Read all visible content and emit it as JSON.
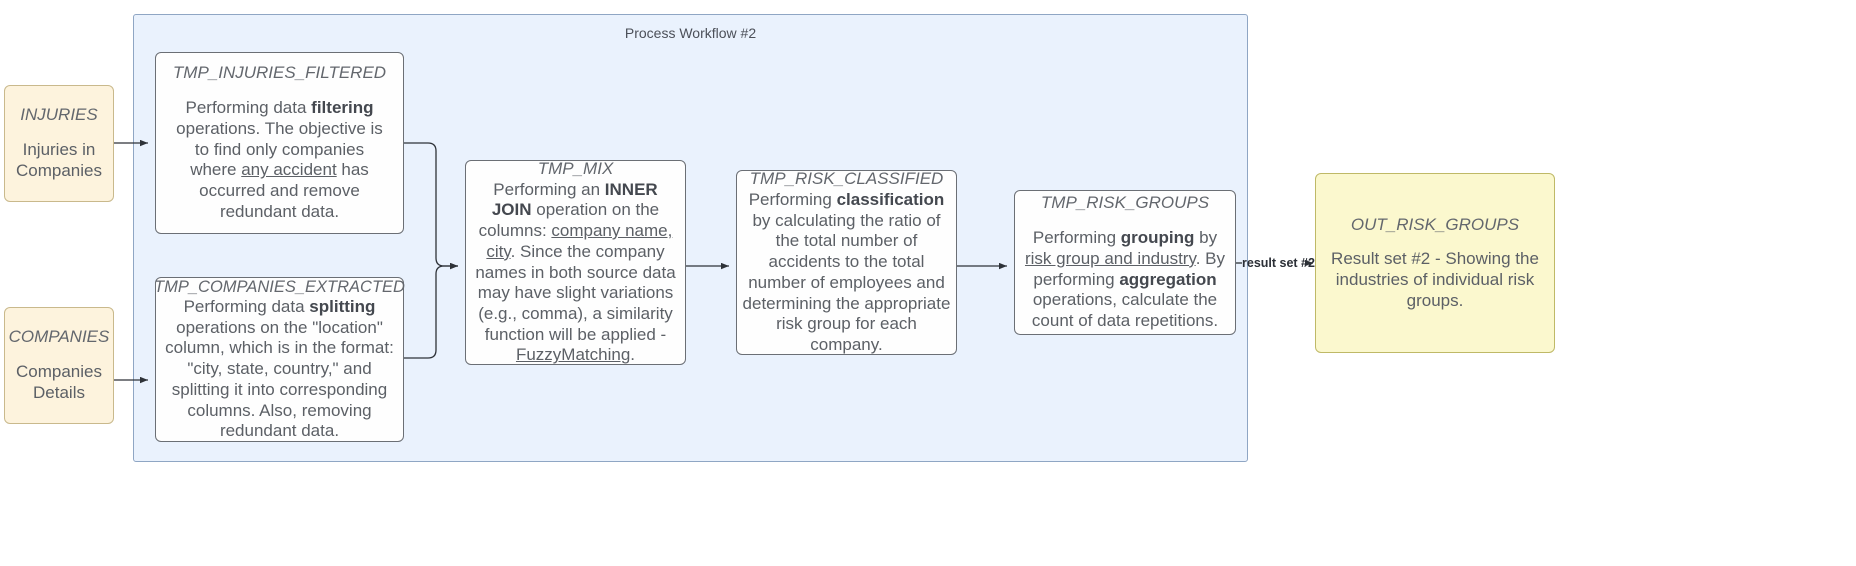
{
  "diagram": {
    "type": "flowchart",
    "cluster": {
      "label": "Process Workflow #2"
    },
    "nodes": {
      "injuries": {
        "id": "INJURIES",
        "title": "INJURIES",
        "body": "Injuries in Companies",
        "kind": "source",
        "color": "#fdf3dd"
      },
      "companies": {
        "id": "COMPANIES",
        "title": "COMPANIES",
        "body": "Companies Details",
        "kind": "source",
        "color": "#fdf3dd"
      },
      "tmp_injuries_filtered": {
        "id": "TMP_INJURIES_FILTERED",
        "title": "TMP_INJURIES_FILTERED",
        "body_parts": [
          {
            "t": "Performing data ",
            "s": "normal"
          },
          {
            "t": "filtering",
            "s": "bold"
          },
          {
            "t": " operations. The objective is to find only companies where ",
            "s": "normal"
          },
          {
            "t": "any accident",
            "s": "underline"
          },
          {
            "t": " has occurred and remove redundant data.",
            "s": "normal"
          }
        ],
        "kind": "process",
        "color": "#fefefe"
      },
      "tmp_companies_extracted": {
        "id": "TMP_COMPANIES_EXTRACTED",
        "title": "TMP_COMPANIES_EXTRACTED",
        "body_parts": [
          {
            "t": "Performing data ",
            "s": "normal"
          },
          {
            "t": "splitting",
            "s": "bold"
          },
          {
            "t": " operations on the \"location\" column, which is in the format: \"city, state, country,\" and splitting it into corresponding columns. Also, removing redundant data.",
            "s": "normal"
          }
        ],
        "kind": "process",
        "color": "#fefefe"
      },
      "tmp_mix": {
        "id": "TMP_MIX",
        "title": "TMP_MIX",
        "body_parts": [
          {
            "t": "Performing an ",
            "s": "normal"
          },
          {
            "t": "INNER JOIN",
            "s": "bold"
          },
          {
            "t": " operation on the columns: ",
            "s": "normal"
          },
          {
            "t": "company name, city",
            "s": "underline"
          },
          {
            "t": ". Since the company names in both source data may have slight variations (e.g., comma), a similarity function will be applied - ",
            "s": "normal"
          },
          {
            "t": "FuzzyMatching",
            "s": "underline"
          },
          {
            "t": ".",
            "s": "normal"
          }
        ],
        "kind": "process",
        "color": "#fefefe"
      },
      "tmp_risk_classified": {
        "id": "TMP_RISK_CLASSIFIED",
        "title": "TMP_RISK_CLASSIFIED",
        "body_parts": [
          {
            "t": "Performing ",
            "s": "normal"
          },
          {
            "t": "classification",
            "s": "bold"
          },
          {
            "t": " by calculating the ratio of the total number of accidents to the total number of employees and determining the appropriate risk group for each company.",
            "s": "normal"
          }
        ],
        "kind": "process",
        "color": "#fefefe"
      },
      "tmp_risk_groups": {
        "id": "TMP_RISK_GROUPS",
        "title": "TMP_RISK_GROUPS",
        "body_parts": [
          {
            "t": "Performing ",
            "s": "normal"
          },
          {
            "t": "grouping",
            "s": "bold"
          },
          {
            "t": " by ",
            "s": "normal"
          },
          {
            "t": "risk group and industry",
            "s": "underline"
          },
          {
            "t": ". By performing ",
            "s": "normal"
          },
          {
            "t": "aggregation",
            "s": "bold"
          },
          {
            "t": " operations, calculate the count of data repetitions.",
            "s": "normal"
          }
        ],
        "kind": "process",
        "color": "#fefefe"
      },
      "out_risk_groups": {
        "id": "OUT_RISK_GROUPS",
        "title": "OUT_RISK_GROUPS",
        "body": "Result set #2 - Showing the industries of individual risk groups.",
        "kind": "sink",
        "color": "#fbf8ce"
      }
    },
    "edges": [
      {
        "from": "INJURIES",
        "to": "TMP_INJURIES_FILTERED",
        "label": ""
      },
      {
        "from": "COMPANIES",
        "to": "TMP_COMPANIES_EXTRACTED",
        "label": ""
      },
      {
        "from": "TMP_INJURIES_FILTERED",
        "to": "TMP_MIX",
        "label": ""
      },
      {
        "from": "TMP_COMPANIES_EXTRACTED",
        "to": "TMP_MIX",
        "label": ""
      },
      {
        "from": "TMP_MIX",
        "to": "TMP_RISK_CLASSIFIED",
        "label": ""
      },
      {
        "from": "TMP_RISK_CLASSIFIED",
        "to": "TMP_RISK_GROUPS",
        "label": ""
      },
      {
        "from": "TMP_RISK_GROUPS",
        "to": "OUT_RISK_GROUPS",
        "label": "result set #2"
      }
    ]
  }
}
